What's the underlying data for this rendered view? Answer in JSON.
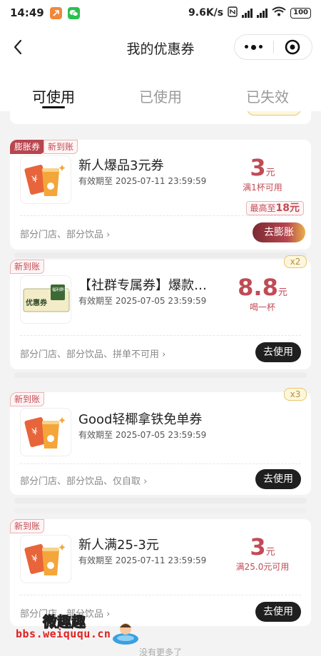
{
  "status_bar": {
    "time": "14:49",
    "net_speed": "9.6K/s",
    "hd1": "HD",
    "hd2": "HD",
    "battery": "100"
  },
  "nav": {
    "title": "我的优惠券"
  },
  "tabs": [
    {
      "label": "可使用",
      "active": true
    },
    {
      "label": "已使用",
      "active": false
    },
    {
      "label": "已失效",
      "active": false
    }
  ],
  "coupons": [
    {
      "badges": [
        "膨胀券",
        "新到账"
      ],
      "title": "新人爆品3元券",
      "expiry": "有效期至 2025-07-11 23:59:59",
      "amount": "3",
      "unit": "元",
      "condition": "满1杯可用",
      "stores": "部分门店、部分饮品 ›",
      "boost_tip_prefix": "最高至",
      "boost_tip_value": "18元",
      "action": "去膨胀"
    },
    {
      "badges": [
        "新到账"
      ],
      "multiplier": "x2",
      "title": "【社群专属券】爆款…",
      "expiry": "有效期至 2025-07-05 23:59:59",
      "amount": "8.8",
      "unit": "元",
      "condition": "喝一杯",
      "stores": "部分门店、部分饮品、拼单不可用 ›",
      "thumb_tag": "福利群专享",
      "thumb_text": "优惠券",
      "action": "去使用"
    },
    {
      "badges": [
        "新到账"
      ],
      "multiplier": "x3",
      "title": "Good轻椰拿铁免单券",
      "expiry": "有效期至 2025-07-05 23:59:59",
      "stores": "部分门店、部分饮品、仅自取 ›",
      "action": "去使用"
    },
    {
      "badges": [
        "新到账"
      ],
      "title": "新人满25-3元",
      "expiry": "有效期至 2025-07-11 23:59:59",
      "amount": "3",
      "unit": "元",
      "condition": "满25.0元可用",
      "stores": "部分门店、部分饮品 ›",
      "action": "去使用"
    }
  ],
  "watermark": {
    "cn": "微趣趣",
    "url": "bbs.weiququ.cn"
  },
  "footer": "没有更多了",
  "colors": {
    "accent": "#c14b55",
    "button": "#1f1f1f",
    "gold": "#e8c66a"
  }
}
